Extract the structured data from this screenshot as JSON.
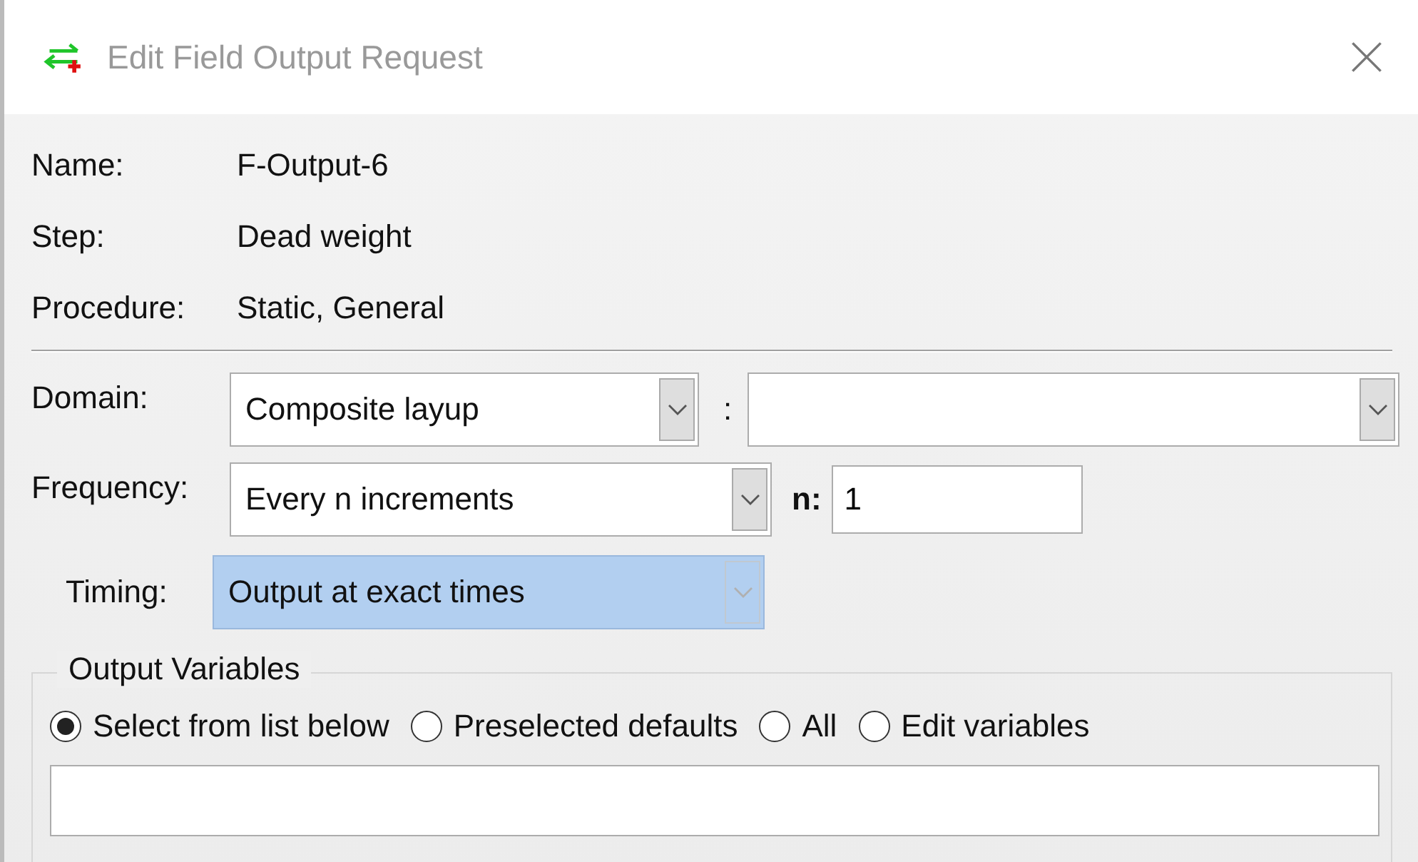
{
  "window": {
    "title": "Edit Field Output Request"
  },
  "info": [
    {
      "label": "Name:",
      "value": "F-Output-6"
    },
    {
      "label": "Step:",
      "value": "Dead weight"
    },
    {
      "label": "Procedure:",
      "value": "Static, General"
    }
  ],
  "domain": {
    "label": "Domain:",
    "value": "Composite layup",
    "separator": ":"
  },
  "frequency": {
    "label": "Frequency:",
    "value": "Every n increments",
    "n_label": "n:",
    "n_value": "1"
  },
  "timing": {
    "label": "Timing:",
    "value": "Output at exact times",
    "highlighted": true,
    "disabled": true
  },
  "output_variables": {
    "title": "Output Variables",
    "options": [
      {
        "label": "Select from list below",
        "selected": true
      },
      {
        "label": "Preselected defaults",
        "selected": false
      },
      {
        "label": "All",
        "selected": false
      },
      {
        "label": "Edit variables",
        "selected": false
      }
    ]
  }
}
